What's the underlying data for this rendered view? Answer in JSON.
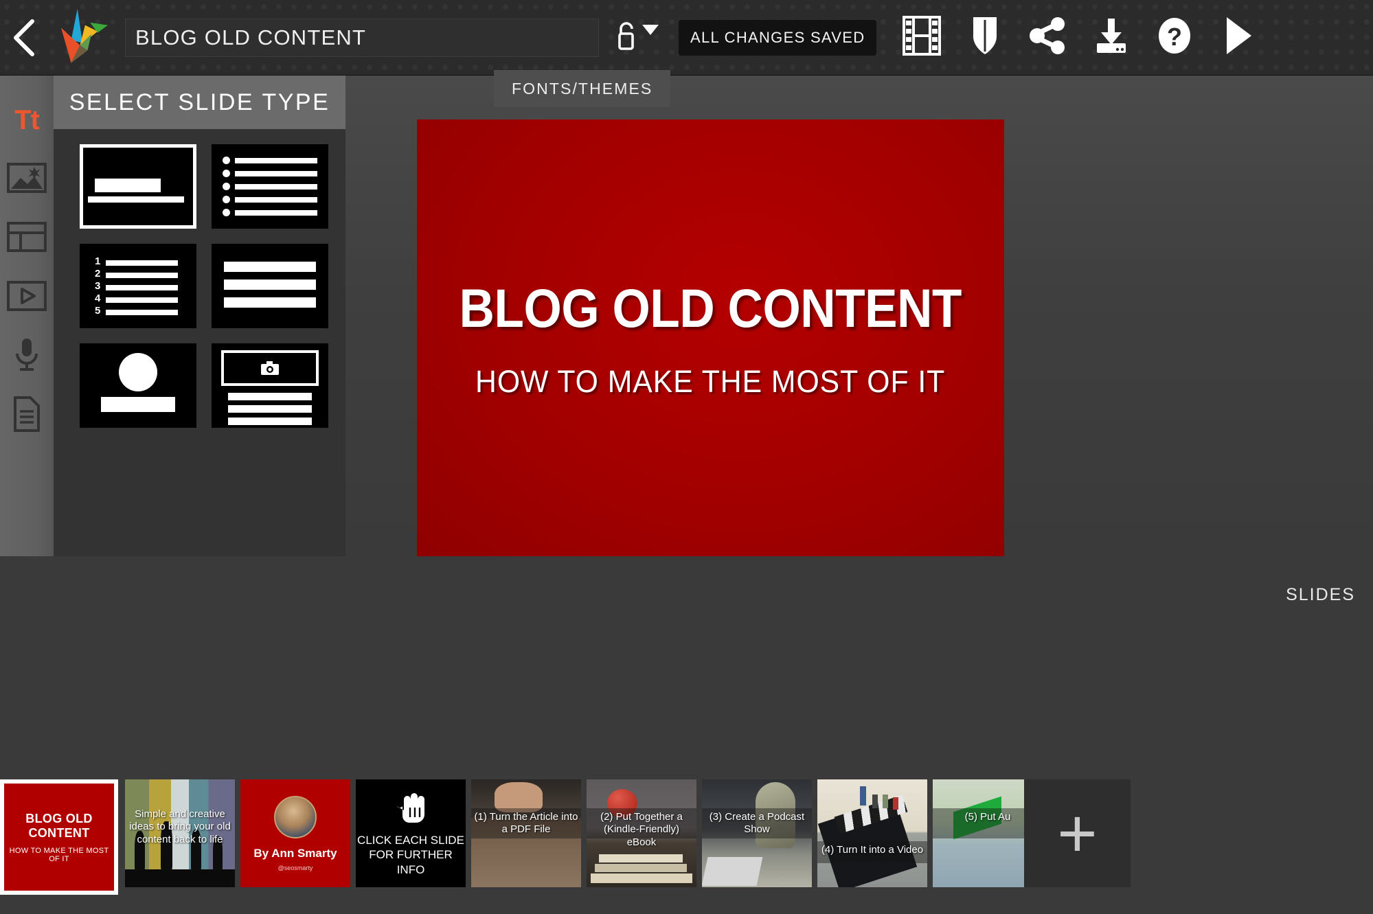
{
  "topbar": {
    "back_icon": "back-chevron-icon",
    "logo_icon": "powtoon-bird-logo",
    "project_title": "BLOG OLD CONTENT",
    "project_title_placeholder": "Untitled Presentation",
    "lock_icon": "unlocked-padlock-icon",
    "lock_dropdown_icon": "chevron-down-icon",
    "save_status": "ALL CHANGES SAVED",
    "buttons": [
      {
        "name": "filmstrip-button",
        "icon": "film-strip-icon"
      },
      {
        "name": "shield-button",
        "icon": "shield-icon"
      },
      {
        "name": "share-button",
        "icon": "share-nodes-icon"
      },
      {
        "name": "export-button",
        "icon": "download-icon"
      },
      {
        "name": "help-button",
        "icon": "question-mark-circle-icon"
      },
      {
        "name": "play-button",
        "icon": "play-triangle-icon"
      }
    ]
  },
  "rail": {
    "items": [
      {
        "name": "sidebar-item-text",
        "icon": "text-tt-icon",
        "label": "Tt",
        "active": true
      },
      {
        "name": "sidebar-item-image",
        "icon": "image-icon",
        "active": false
      },
      {
        "name": "sidebar-item-layout",
        "icon": "layout-icon",
        "active": false
      },
      {
        "name": "sidebar-item-video",
        "icon": "video-play-icon",
        "active": false
      },
      {
        "name": "sidebar-item-voice",
        "icon": "microphone-icon",
        "active": false
      },
      {
        "name": "sidebar-item-notes",
        "icon": "document-icon",
        "active": false
      }
    ]
  },
  "slide_type_panel": {
    "heading": "SELECT SLIDE TYPE",
    "options": [
      {
        "name": "slide-type-title",
        "icon": "title-slide-icon",
        "selected": true
      },
      {
        "name": "slide-type-bullets",
        "icon": "bulleted-list-slide-icon",
        "selected": false
      },
      {
        "name": "slide-type-numbered",
        "icon": "numbered-list-slide-icon",
        "selected": false
      },
      {
        "name": "slide-type-lines",
        "icon": "text-lines-slide-icon",
        "selected": false
      },
      {
        "name": "slide-type-photo-caption",
        "icon": "circle-photo-slide-icon",
        "selected": false
      },
      {
        "name": "slide-type-image-text",
        "icon": "camera-image-text-slide-icon",
        "selected": false
      }
    ],
    "numbered_labels": [
      "1",
      "2",
      "3",
      "4",
      "5"
    ]
  },
  "stage": {
    "fonts_themes_tab": "FONTS/THEMES",
    "slide": {
      "title": "BLOG OLD CONTENT",
      "subtitle": "HOW TO MAKE THE MOST OF IT",
      "background_color": "#a80000"
    }
  },
  "filmstrip": {
    "label": "SLIDES",
    "add_slide_icon": "plus-icon",
    "add_slide_label": "+",
    "slides": [
      {
        "index": 1,
        "name": "slide-thumb-1",
        "selected": true,
        "title": "BLOG OLD CONTENT",
        "subtitle": "HOW TO MAKE THE MOST OF IT"
      },
      {
        "index": 2,
        "name": "slide-thumb-2",
        "selected": false,
        "caption": "Simple and creative ideas to bring your old content back to life"
      },
      {
        "index": 3,
        "name": "slide-thumb-3",
        "selected": false,
        "author": "By Ann Smarty",
        "handle": "@seosmarty"
      },
      {
        "index": 4,
        "name": "slide-thumb-4",
        "selected": false,
        "caption": "CLICK EACH SLIDE FOR FURTHER INFO",
        "icon": "pointing-hand-icon"
      },
      {
        "index": 5,
        "name": "slide-thumb-5",
        "selected": false,
        "caption": "(1) Turn the Article into a PDF File"
      },
      {
        "index": 6,
        "name": "slide-thumb-6",
        "selected": false,
        "caption": "(2) Put Together a (Kindle-Friendly) eBook"
      },
      {
        "index": 7,
        "name": "slide-thumb-7",
        "selected": false,
        "caption": "(3) Create a Podcast Show"
      },
      {
        "index": 8,
        "name": "slide-thumb-8",
        "selected": false,
        "caption": "(4) Turn It into a Video"
      },
      {
        "index": 9,
        "name": "slide-thumb-9",
        "selected": false,
        "caption": "(5) Put Au"
      }
    ]
  },
  "colors": {
    "accent_orange": "#f0562d",
    "slide_red": "#a80000",
    "topbar_dark": "#2b2b2b",
    "panel_grey": "#6b6b6b"
  }
}
